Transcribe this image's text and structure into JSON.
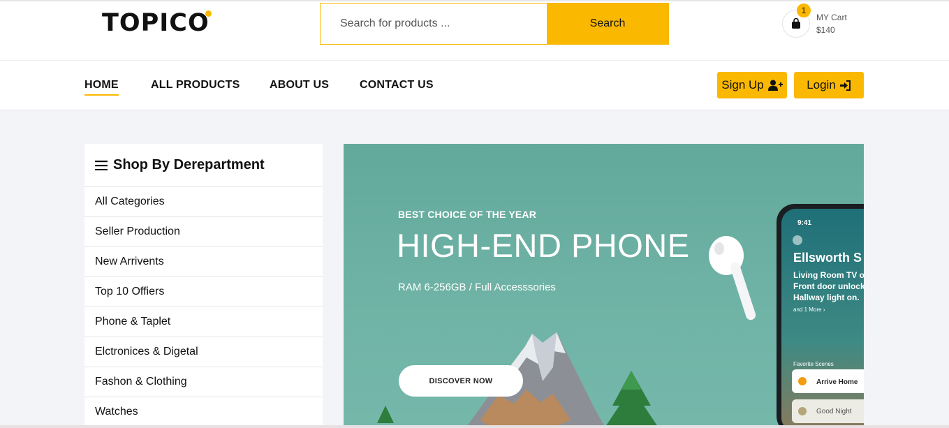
{
  "header": {
    "logo": "TOPIC",
    "logo_tail": "O",
    "search": {
      "placeholder": "Search for products ...",
      "button_label": "Search"
    },
    "cart": {
      "count": "1",
      "label": "MY Cart",
      "total": "$140"
    }
  },
  "nav": {
    "items": [
      {
        "label": "HOME",
        "active": true
      },
      {
        "label": "ALL PRODUCTS",
        "active": false
      },
      {
        "label": "ABOUT US",
        "active": false
      },
      {
        "label": "CONTACT US",
        "active": false
      }
    ],
    "signup_label": "Sign Up",
    "login_label": "Login"
  },
  "sidebar": {
    "title": "Shop By Derepartment",
    "items": [
      {
        "label": "All Categories"
      },
      {
        "label": "Seller Production"
      },
      {
        "label": "New Arrivents"
      },
      {
        "label": "Top 10 Offiers"
      },
      {
        "label": "Phone & Taplet"
      },
      {
        "label": "Elctronices & Digetal"
      },
      {
        "label": "Fashon & Clothing"
      },
      {
        "label": "Watches"
      }
    ]
  },
  "banner": {
    "kicker": "BEST CHOICE OF THE YEAR",
    "title": "HIGH-END PHONE",
    "subtitle": "RAM 6-256GB / Full Accesssories",
    "cta": "DISCOVER NOW",
    "phone": {
      "time": "9:41",
      "heading": "Ellsworth S",
      "lines": [
        "Living Room TV o",
        "Front door unlock",
        "Hallway light on."
      ],
      "more": "and 1 More ›",
      "scenes_label": "Favorite Scenes",
      "scene_1": "Arrive Home",
      "scene_2": "Good Night"
    }
  },
  "colors": {
    "accent": "#fbb800",
    "banner_bg": "#6aae9f",
    "page_bg": "#f3f4f8"
  }
}
